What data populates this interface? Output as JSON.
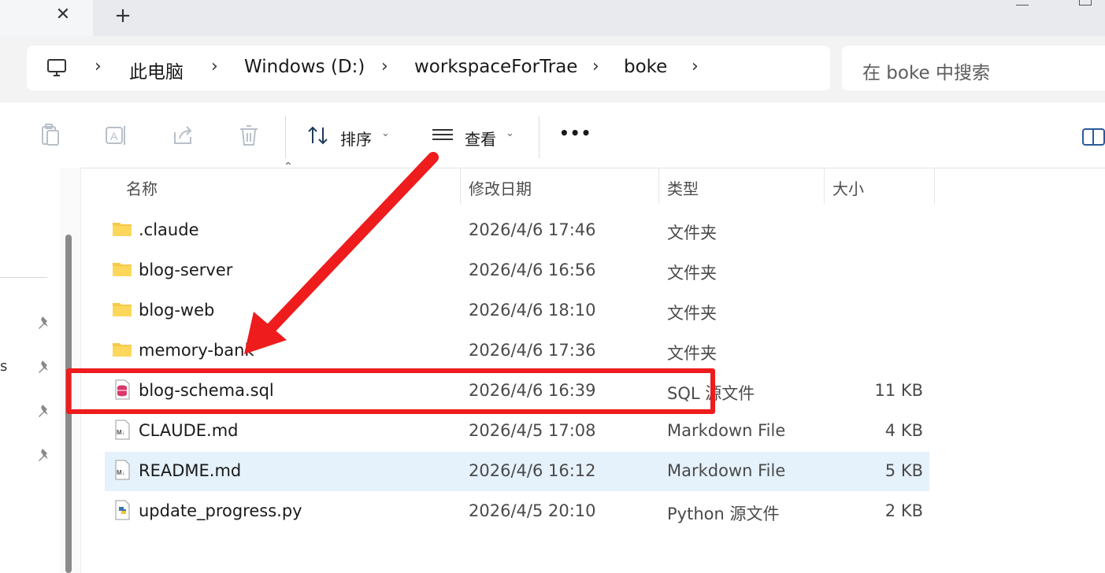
{
  "window": {
    "tab_close_icon": "close-icon",
    "tab_add_icon": "plus-icon"
  },
  "address": {
    "icon": "computer-icon",
    "crumbs": [
      "此电脑",
      "Windows (D:)",
      "workspaceForTrae",
      "boke"
    ],
    "search_placeholder": "在 boke 中搜索"
  },
  "toolbar": {
    "sort_label": "排序",
    "view_label": "查看",
    "more_label": "•••"
  },
  "columns": {
    "name": "名称",
    "date": "修改日期",
    "type": "类型",
    "size": "大小"
  },
  "files": [
    {
      "name": ".claude",
      "date": "2026/4/6 17:46",
      "type": "文件夹",
      "size": "",
      "icon": "folder-icon"
    },
    {
      "name": "blog-server",
      "date": "2026/4/6 16:56",
      "type": "文件夹",
      "size": "",
      "icon": "folder-icon"
    },
    {
      "name": "blog-web",
      "date": "2026/4/6 18:10",
      "type": "文件夹",
      "size": "",
      "icon": "folder-icon"
    },
    {
      "name": "memory-bank",
      "date": "2026/4/6 17:36",
      "type": "文件夹",
      "size": "",
      "icon": "folder-icon"
    },
    {
      "name": "blog-schema.sql",
      "date": "2026/4/6 16:39",
      "type": "SQL 源文件",
      "size": "11 KB",
      "icon": "database-file-icon"
    },
    {
      "name": "CLAUDE.md",
      "date": "2026/4/5 17:08",
      "type": "Markdown File",
      "size": "4 KB",
      "icon": "markdown-file-icon"
    },
    {
      "name": "README.md",
      "date": "2026/4/6 16:12",
      "type": "Markdown File",
      "size": "5 KB",
      "icon": "markdown-file-icon"
    },
    {
      "name": "update_progress.py",
      "date": "2026/4/5 20:10",
      "type": "Python 源文件",
      "size": "2 KB",
      "icon": "python-file-icon"
    }
  ],
  "sidebar": {
    "partial_text": "s"
  },
  "annotation": {
    "highlight_color": "#ee1c1c",
    "selected_row_color": "#e5f1fb"
  }
}
